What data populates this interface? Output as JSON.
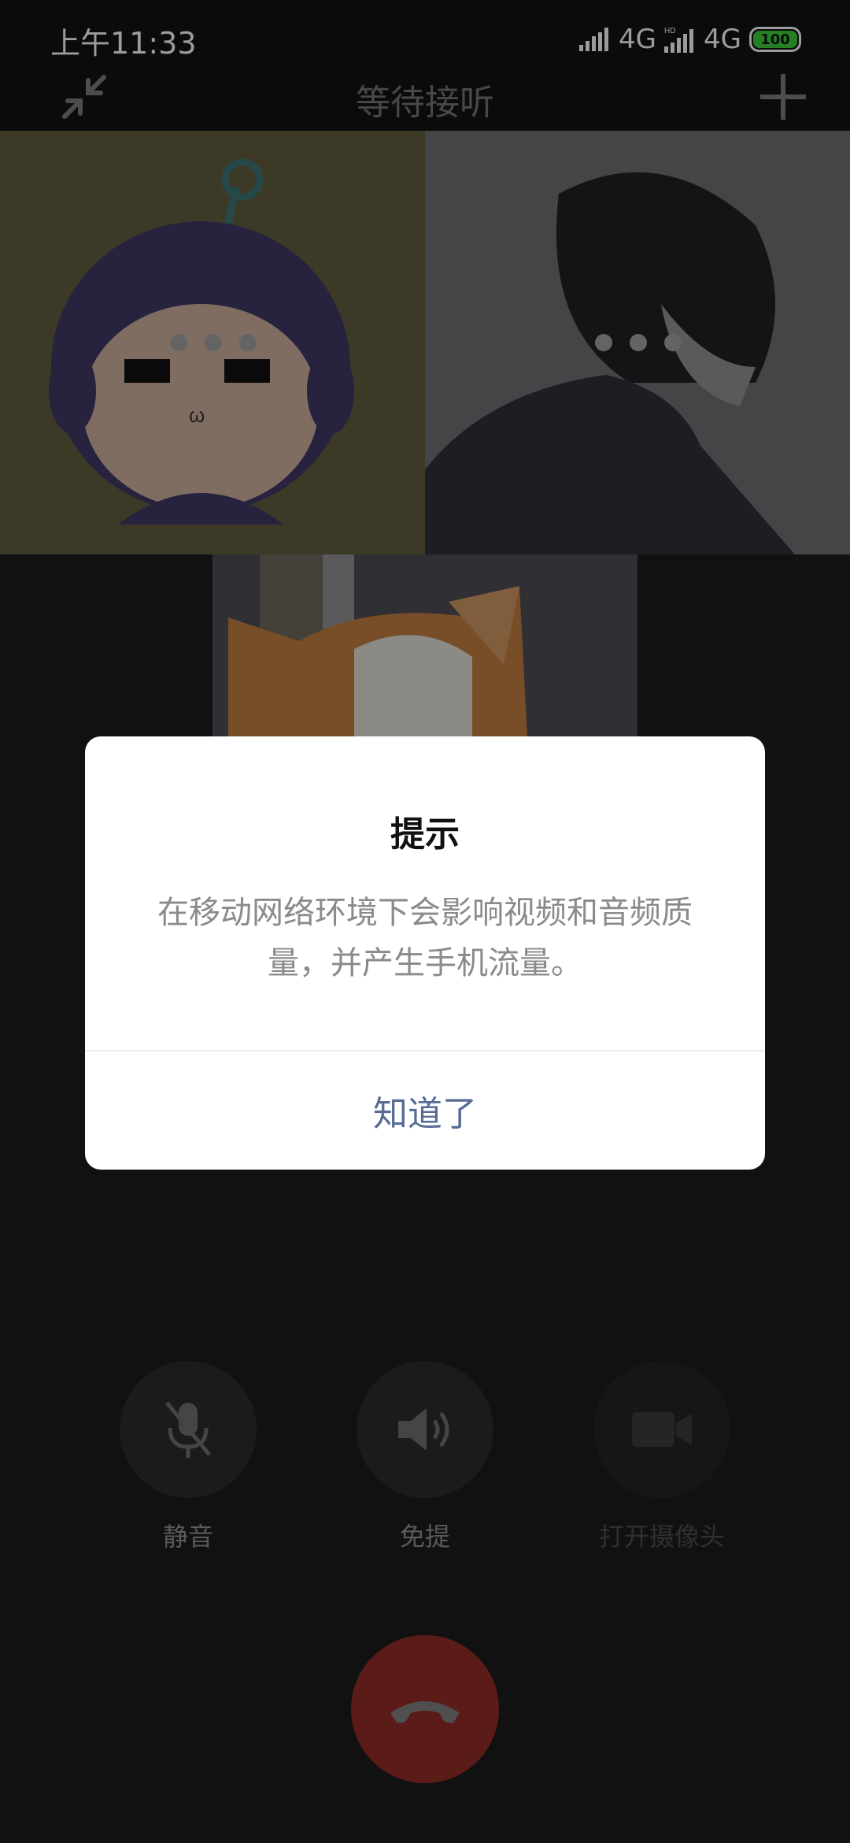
{
  "status_bar": {
    "time": "上午11:33",
    "network_1": "4G",
    "network_2": "4G",
    "battery": "100"
  },
  "header": {
    "title": "等待接听"
  },
  "controls": {
    "mute_label": "静音",
    "speaker_label": "免提",
    "camera_label": "打开摄像头"
  },
  "dialog": {
    "title": "提示",
    "message": "在移动网络环境下会影响视频和音频质量，并产生手机流量。",
    "button": "知道了"
  },
  "colors": {
    "hangup": "#8a2a27",
    "dialog_button": "#576b95",
    "battery": "#39c43a"
  }
}
